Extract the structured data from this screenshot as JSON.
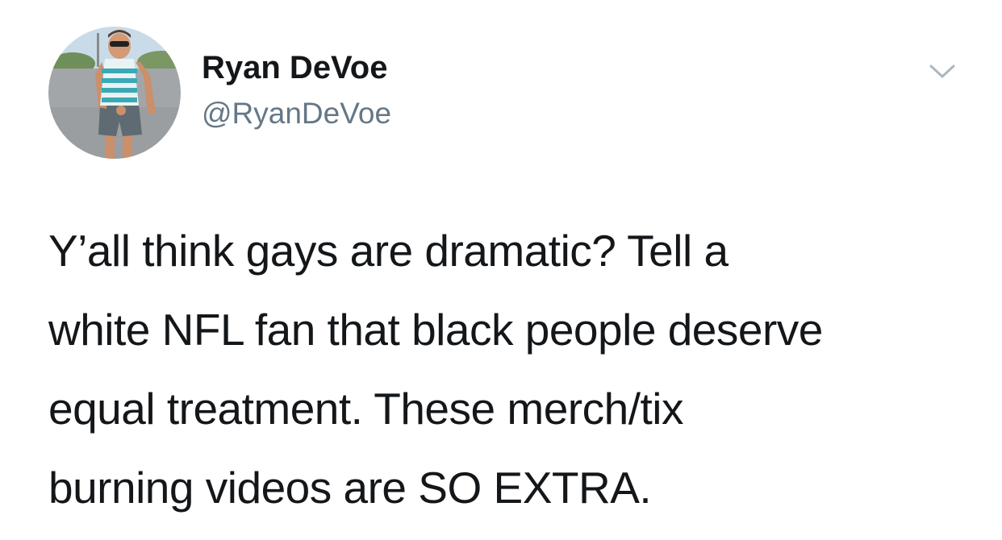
{
  "tweet": {
    "author": {
      "display_name": "Ryan DeVoe",
      "handle": "@RyanDeVoe",
      "avatar_icon": "profile-photo"
    },
    "menu_icon": "chevron-down-icon",
    "text_lines": [
      "Y’all think gays are dramatic? Tell a",
      "white NFL fan that black people deserve",
      "equal treatment. These merch/tix",
      "burning videos are SO EXTRA."
    ]
  },
  "colors": {
    "text_primary": "#14171a",
    "text_secondary": "#657786",
    "chevron": "#aab8c2",
    "background": "#ffffff"
  }
}
